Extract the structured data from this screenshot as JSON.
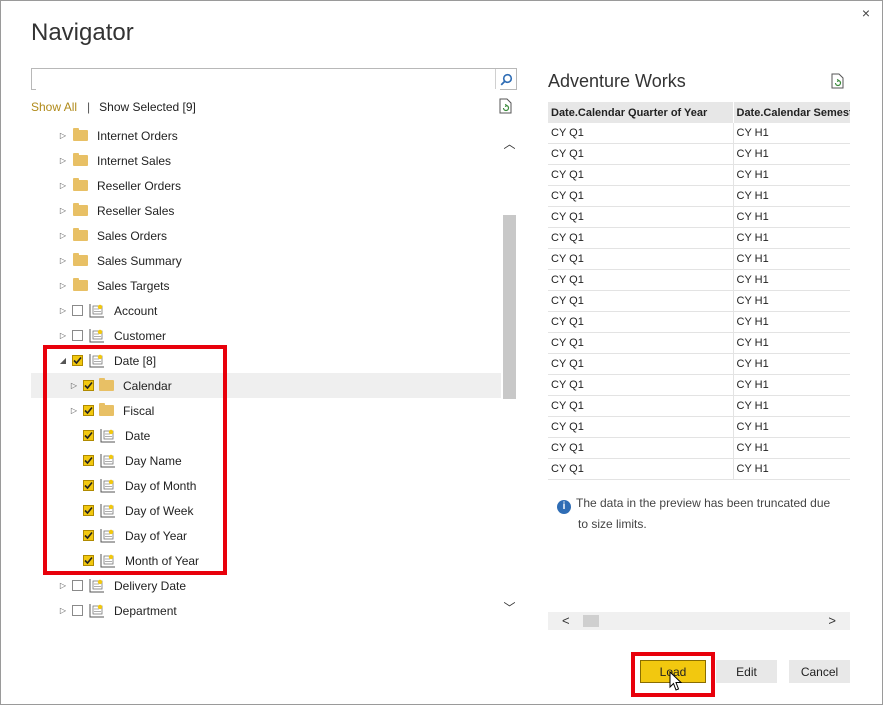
{
  "window": {
    "title": "Navigator",
    "close_glyph": "×"
  },
  "search": {
    "value": "",
    "placeholder": ""
  },
  "filters": {
    "show_all": "Show All",
    "separator": "|",
    "show_selected": "Show Selected [9]"
  },
  "tree": {
    "items": [
      {
        "label": "Internet Orders",
        "type": "folder"
      },
      {
        "label": "Internet Sales",
        "type": "folder"
      },
      {
        "label": "Reseller Orders",
        "type": "folder"
      },
      {
        "label": "Reseller Sales",
        "type": "folder"
      },
      {
        "label": "Sales Orders",
        "type": "folder"
      },
      {
        "label": "Sales Summary",
        "type": "folder"
      },
      {
        "label": "Sales Targets",
        "type": "folder"
      },
      {
        "label": "Account",
        "type": "dimension",
        "checked": false
      },
      {
        "label": "Customer",
        "type": "dimension",
        "checked": false
      },
      {
        "label": "Date [8]",
        "type": "dimension",
        "checked": true,
        "expanded": true
      },
      {
        "label": "Calendar",
        "type": "folder",
        "checked": true
      },
      {
        "label": "Fiscal",
        "type": "folder",
        "checked": true
      },
      {
        "label": "Date",
        "type": "attribute",
        "checked": true
      },
      {
        "label": "Day Name",
        "type": "attribute",
        "checked": true
      },
      {
        "label": "Day of Month",
        "type": "attribute",
        "checked": true
      },
      {
        "label": "Day of Week",
        "type": "attribute",
        "checked": true
      },
      {
        "label": "Day of Year",
        "type": "attribute",
        "checked": true
      },
      {
        "label": "Month of Year",
        "type": "attribute",
        "checked": true
      },
      {
        "label": "Delivery Date",
        "type": "dimension",
        "checked": false
      },
      {
        "label": "Department",
        "type": "dimension",
        "checked": false
      }
    ]
  },
  "preview": {
    "title": "Adventure Works",
    "columns": [
      "Date.Calendar Quarter of Year",
      "Date.Calendar Semester"
    ],
    "rows": [
      [
        "CY Q1",
        "CY H1"
      ],
      [
        "CY Q1",
        "CY H1"
      ],
      [
        "CY Q1",
        "CY H1"
      ],
      [
        "CY Q1",
        "CY H1"
      ],
      [
        "CY Q1",
        "CY H1"
      ],
      [
        "CY Q1",
        "CY H1"
      ],
      [
        "CY Q1",
        "CY H1"
      ],
      [
        "CY Q1",
        "CY H1"
      ],
      [
        "CY Q1",
        "CY H1"
      ],
      [
        "CY Q1",
        "CY H1"
      ],
      [
        "CY Q1",
        "CY H1"
      ],
      [
        "CY Q1",
        "CY H1"
      ],
      [
        "CY Q1",
        "CY H1"
      ],
      [
        "CY Q1",
        "CY H1"
      ],
      [
        "CY Q1",
        "CY H1"
      ],
      [
        "CY Q1",
        "CY H1"
      ],
      [
        "CY Q1",
        "CY H1"
      ]
    ],
    "note_line1": "The data in the preview has been truncated due",
    "note_line2": "to size limits."
  },
  "buttons": {
    "load": "Load",
    "edit": "Edit",
    "cancel": "Cancel"
  },
  "colors": {
    "accent": "#f2c80f",
    "highlight_box": "#e8000b",
    "info": "#2f6db5"
  }
}
